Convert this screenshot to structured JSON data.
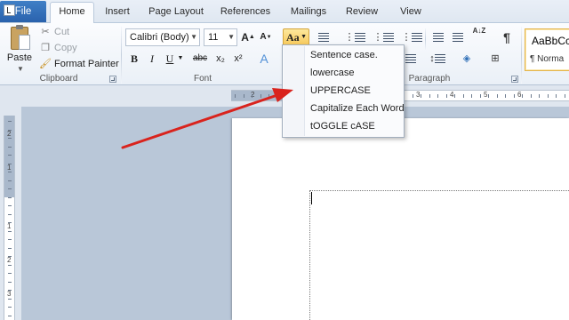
{
  "tabs": {
    "file": "File",
    "home": "Home",
    "insert": "Insert",
    "page_layout": "Page Layout",
    "references": "References",
    "mailings": "Mailings",
    "review": "Review",
    "view": "View"
  },
  "clipboard": {
    "paste": "Paste",
    "cut": "Cut",
    "copy": "Copy",
    "format_painter": "Format Painter",
    "group_label": "Clipboard"
  },
  "font": {
    "name": "Calibri (Body)",
    "size": "11",
    "grow_glyph": "A",
    "shrink_glyph": "A",
    "change_case_glyph": "Aa",
    "bold": "B",
    "italic": "I",
    "underline": "U",
    "strikethrough": "abc",
    "subscript": "x₂",
    "superscript": "x²",
    "group_label": "Font"
  },
  "paragraph": {
    "sort_glyph": "A↓Z",
    "pilcrow": "¶",
    "group_label": "Paragraph"
  },
  "styles": {
    "sample": "AaBbCc",
    "normal": "¶ Norma"
  },
  "change_case_menu": [
    {
      "label": "Sentence case."
    },
    {
      "label": "lowercase"
    },
    {
      "label": "UPPERCASE"
    },
    {
      "label": "Capitalize Each Word"
    },
    {
      "label": "tOGGLE cASE"
    }
  ],
  "ruler": {
    "h_numbers": [
      "2",
      "1",
      "1",
      "2",
      "3",
      "4",
      "5",
      "6"
    ],
    "v_numbers": [
      "2",
      "1",
      "1",
      "2",
      "3"
    ]
  },
  "colors": {
    "file_tab": "#2a62ad",
    "change_case_highlight": "#f7c85a",
    "annotation_arrow": "#d9231d"
  },
  "icons": {
    "cut": "scissors-icon",
    "copy": "copy-icon",
    "format_painter": "paintbrush-icon",
    "paste": "clipboard-icon"
  }
}
